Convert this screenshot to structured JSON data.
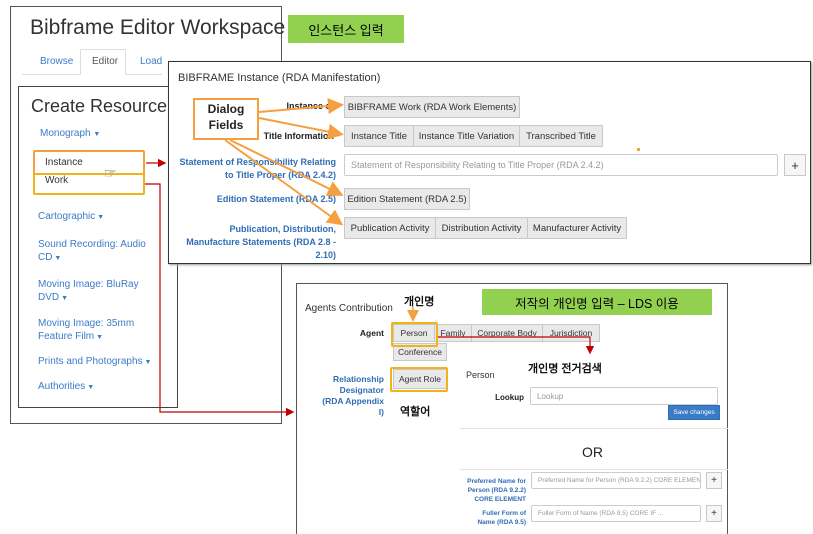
{
  "workspace": {
    "title": "Bibframe Editor Workspace",
    "tabs": [
      "Browse",
      "Editor",
      "Load"
    ],
    "create_resource": "Create Resource",
    "monograph": "Monograph",
    "instance": "Instance",
    "work": "Work",
    "menu": [
      "Cartographic",
      "Sound Recording: Audio CD",
      "Moving Image: BluRay DVD",
      "Moving Image: 35mm Feature Film",
      "Prints and Photographs",
      "Authorities"
    ]
  },
  "callouts": {
    "instance_input": "인스턴스 입력",
    "dialog_fields_line1": "Dialog",
    "dialog_fields_line2": "Fields",
    "agent_input": "저작의 개인명 입력 – LDS 이용",
    "person_name": "개인명",
    "person_search": "개인명 전거검색",
    "role_term": "역할어"
  },
  "instance_dialog": {
    "title": "BIBFRAME Instance (RDA Manifestation)",
    "instance_of_label": "Instance of",
    "instance_of_button": "BIBFRAME Work (RDA Work Elements)",
    "title_info_label": "Title Information",
    "title_buttons": [
      "Instance Title",
      "Instance Title Variation",
      "Transcribed Title"
    ],
    "sor_label": "Statement of Responsibility Relating to Title Proper (RDA 2.4.2)",
    "sor_placeholder": "Statement of Responsibility Relating to Title Proper (RDA 2.4.2)",
    "plus": "+",
    "edition_label": "Edition Statement (RDA 2.5)",
    "edition_button": "Edition Statement (RDA 2.5)",
    "pub_label": "Publication, Distribution, Manufacture Statements (RDA 2.8 - 2.10)",
    "pub_buttons": [
      "Publication Activity",
      "Distribution Activity",
      "Manufacturer Activity"
    ]
  },
  "agents_dialog": {
    "title": "Agents Contribution",
    "agent_label": "Agent",
    "agent_buttons": [
      "Person",
      "Family",
      "Corporate Body",
      "Jurisdiction"
    ],
    "conference": "Conference",
    "rel_label": "Relationship Designator (RDA Appendix I)",
    "agent_role": "Agent Role",
    "person_heading": "Person",
    "lookup_label": "Lookup",
    "lookup_placeholder": "Lookup",
    "save": "Save changes",
    "or": "OR",
    "pref_label": "Preferred Name for Person (RDA 9.2.2) CORE ELEMENT",
    "pref_placeholder": "Preferred Name for Person (RDA 9.2.2) CORE ELEMEN",
    "fuller_label": "Fuller Form of Name (RDA 9.5)",
    "fuller_placeholder": "Fuller Form of Name (RDA 9.5) CORE IF ...",
    "plus": "+"
  },
  "colors": {
    "accent": "#3a7bc8",
    "callout_orange": "#f5a040",
    "callout_yellow": "#f2b21c",
    "green": "#92d050",
    "arrow_red": "#c00000"
  }
}
